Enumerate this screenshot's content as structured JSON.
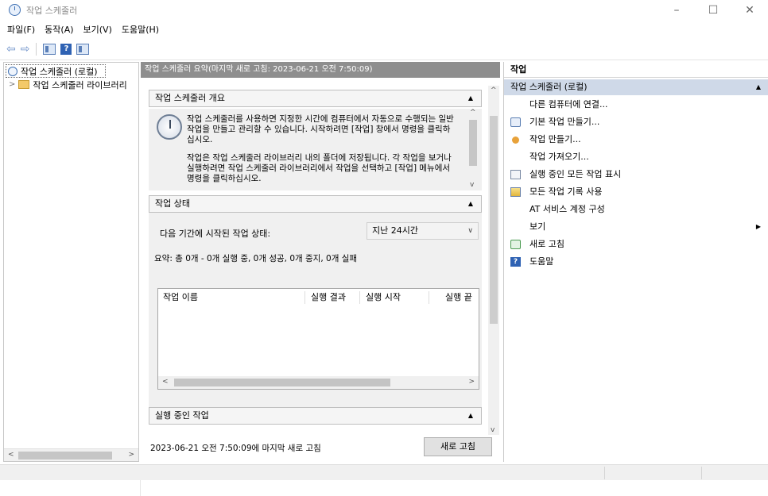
{
  "window": {
    "title": "작업 스케줄러",
    "minimize": "–",
    "maximize": "☐",
    "close": "✕"
  },
  "menu": [
    "파일(F)",
    "동작(A)",
    "보기(V)",
    "도움말(H)"
  ],
  "toolbar": {
    "back_icon": "back-arrow-icon",
    "forward_icon": "forward-arrow-icon",
    "help_glyph": "?"
  },
  "tree": {
    "root": "작업 스케줄러 (로컬)",
    "child": "작업 스케줄러 라이브러리",
    "expander": ">",
    "scroll_left": "<",
    "scroll_right": ">"
  },
  "center": {
    "header": "작업 스케줄러 요약(마지막 새로 고침: 2023-06-21 오전 7:50:09)",
    "overview": {
      "title": "작업 스케줄러 개요",
      "para1": "작업 스케줄러를 사용하면 지정한 시간에 컴퓨터에서 자동으로 수행되는 일반 작업을 만들고 관리할 수 있습니다. 시작하려면 [작업] 창에서 명령을 클릭하십시오.",
      "para2": "작업은 작업 스케줄러 라이브러리 내의 폴더에 저장됩니다. 각 작업을 보거나 실행하려면 작업 스케줄러 라이브러리에서 작업을 선택하고 [작업] 메뉴에서 명령을 클릭하십시오."
    },
    "status": {
      "title": "작업 상태",
      "label": "다음 기간에 시작된 작업 상태:",
      "select_value": "지난 24시간",
      "summary": "요약: 총 0개 - 0개 실행 중, 0개 성공, 0개 중지, 0개 실패",
      "columns": [
        "작업 이름",
        "실행 결과",
        "실행 시작",
        "실행 끝"
      ]
    },
    "running": {
      "title": "실행 중인 작업"
    },
    "last_refresh": "2023-06-21 오전 7:50:09에 마지막 새로 고침",
    "refresh_button": "새로 고침"
  },
  "actions": {
    "header": "작업",
    "group": "작업 스케줄러 (로컬)",
    "items": [
      {
        "label": "다른 컴퓨터에 연결...",
        "icon": ""
      },
      {
        "label": "기본 작업 만들기...",
        "icon": "basic-task-icon"
      },
      {
        "label": "작업 만들기...",
        "icon": "create-task-icon"
      },
      {
        "label": "작업 가져오기...",
        "icon": ""
      },
      {
        "label": "실행 중인 모든 작업 표시",
        "icon": "running-tasks-icon"
      },
      {
        "label": "모든 작업 기록 사용",
        "icon": "history-icon"
      },
      {
        "label": "AT 서비스 계정 구성",
        "icon": ""
      },
      {
        "label": "보기",
        "icon": ""
      },
      {
        "label": "새로 고침",
        "icon": "refresh-icon"
      },
      {
        "label": "도움말",
        "icon": "help-icon"
      }
    ]
  },
  "colors": {
    "header_gray": "#8e8e8e",
    "actions_group_bg": "#cfd9e8",
    "accent_blue": "#2f62b3"
  }
}
